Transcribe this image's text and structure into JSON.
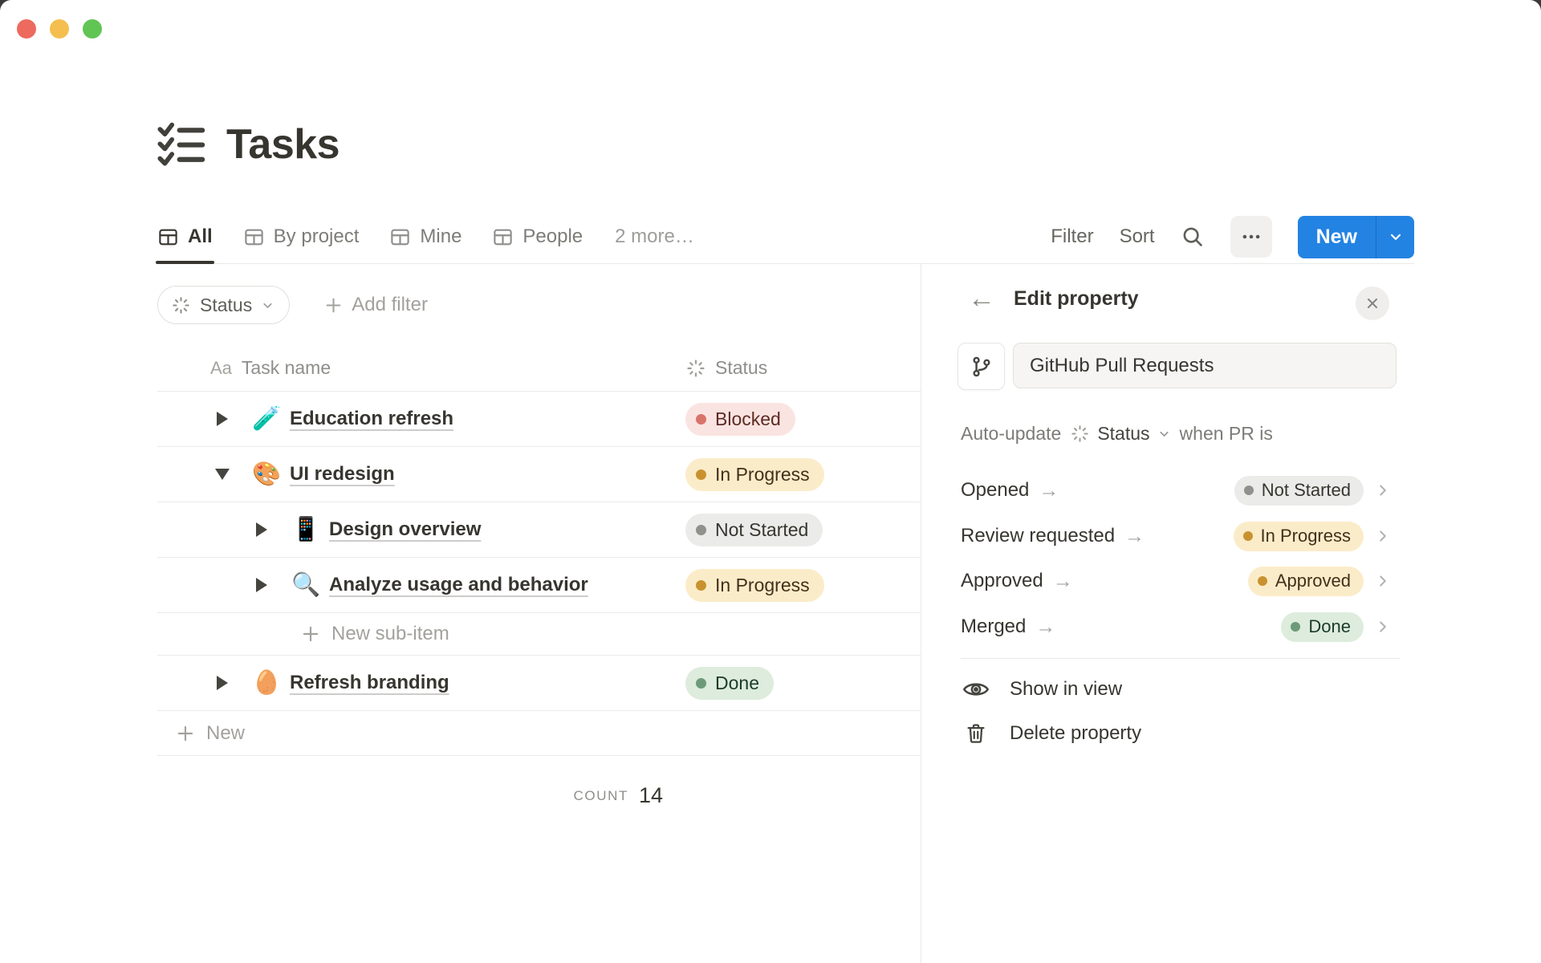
{
  "window": {
    "controls": [
      "close",
      "minimize",
      "zoom"
    ]
  },
  "page": {
    "title": "Tasks",
    "icon": "checklist-icon"
  },
  "tabs": [
    {
      "label": "All",
      "active": true
    },
    {
      "label": "By project",
      "active": false
    },
    {
      "label": "Mine",
      "active": false
    },
    {
      "label": "People",
      "active": false
    }
  ],
  "tabs_more": "2 more…",
  "toolbar": {
    "filter_label": "Filter",
    "sort_label": "Sort",
    "more_label": "•••",
    "new_label": "New"
  },
  "filter_bar": {
    "status_chip_label": "Status",
    "add_filter_label": "Add filter",
    "plus": "+"
  },
  "table": {
    "header": {
      "name_icon": "Aa",
      "name_label": "Task name",
      "status_label": "Status"
    },
    "rows": [
      {
        "title": "Education refresh",
        "emoji": "🧪",
        "toggle": "collapsed",
        "indent": 0,
        "status_label": "Blocked",
        "status_color": "red"
      },
      {
        "title": "UI redesign",
        "emoji": "🎨",
        "toggle": "expanded",
        "indent": 0,
        "status_label": "In Progress",
        "status_color": "yellow"
      },
      {
        "title": "Design overview",
        "emoji": "📱",
        "toggle": "collapsed",
        "indent": 1,
        "status_label": "Not Started",
        "status_color": "gray"
      },
      {
        "title": "Analyze usage and behavior",
        "emoji": "🔍",
        "toggle": "collapsed",
        "indent": 1,
        "status_label": "In Progress",
        "status_color": "yellow"
      },
      {
        "title": "Refresh branding",
        "emoji": "🥚",
        "toggle": "collapsed",
        "indent": 0,
        "status_label": "Done",
        "status_color": "green"
      }
    ],
    "new_sub_item_label": "New sub-item",
    "new_row_label": "New",
    "count_label": "COUNT",
    "count_value": "14"
  },
  "panel": {
    "title": "Edit property",
    "property_name": "GitHub Pull Requests",
    "auto_update_prefix": "Auto-update",
    "auto_update_property": "Status",
    "auto_update_suffix": "when PR is",
    "mappings": [
      {
        "event": "Opened",
        "status_label": "Not Started",
        "status_color": "gray"
      },
      {
        "event": "Review requested",
        "status_label": "In Progress",
        "status_color": "yellow"
      },
      {
        "event": "Approved",
        "status_label": "Approved",
        "status_color": "yellow"
      },
      {
        "event": "Merged",
        "status_label": "Done",
        "status_color": "green"
      }
    ],
    "show_in_view_label": "Show in view",
    "delete_property_label": "Delete property"
  },
  "colors": {
    "accent_blue": "#2383e2",
    "text_dark": "#37352f",
    "text_gray": "#787774",
    "pill_red_bg": "#fae4e1",
    "pill_red_dot": "#d8736a",
    "pill_red_text": "#5d2b22",
    "pill_yellow_bg": "#fbecc9",
    "pill_yellow_dot": "#c9922f",
    "pill_yellow_text": "#42301b",
    "pill_gray_bg": "#ebebe9",
    "pill_gray_dot": "#90908c",
    "pill_gray_text": "#37352f",
    "pill_green_bg": "#ddecdc",
    "pill_green_dot": "#6d9b79",
    "pill_green_text": "#1d3b2a"
  }
}
